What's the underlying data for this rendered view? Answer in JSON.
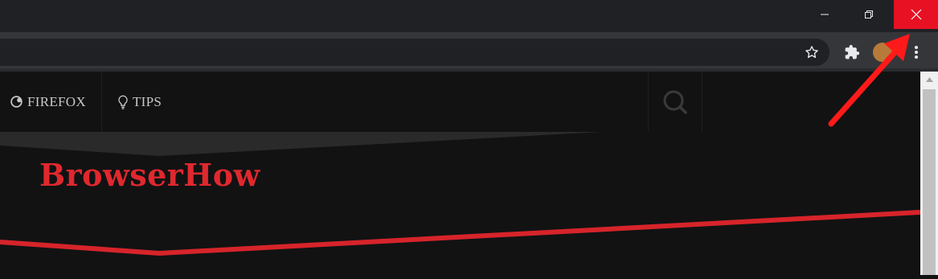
{
  "window_controls": {
    "minimize_icon": "minimize-icon",
    "restore_icon": "restore-icon",
    "close_icon": "close-icon",
    "close_color": "#e81123"
  },
  "toolbar": {
    "bookmark_icon": "star-icon",
    "extensions_icon": "puzzle-icon",
    "menu_icon": "kebab-menu-icon"
  },
  "site_nav": {
    "items": [
      {
        "label": "FIREFOX",
        "icon": "firefox-icon"
      },
      {
        "label": "TIPS",
        "icon": "lightbulb-icon"
      }
    ],
    "search_icon": "search-icon"
  },
  "hero": {
    "brand": "BrowserHow",
    "brand_color": "#e0282e"
  },
  "annotation": {
    "arrow_color": "#ff1a1a",
    "points_to": "close-button"
  }
}
